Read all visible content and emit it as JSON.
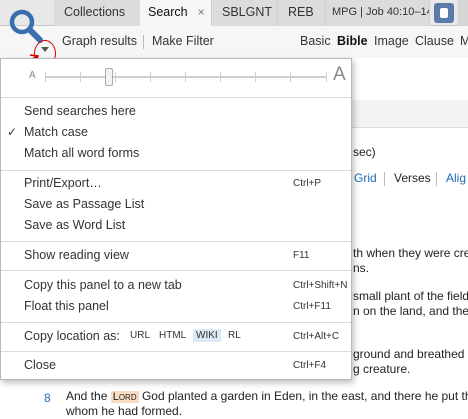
{
  "tabs": [
    {
      "label": "Collections",
      "active": false
    },
    {
      "label": "Search",
      "active": true,
      "close": "×"
    },
    {
      "label": "SBLGNT",
      "active": false
    },
    {
      "label": "REB",
      "active": false
    },
    {
      "label": "MPG | Job 40:10–14",
      "active": false
    }
  ],
  "toolbar": {
    "graph_results": "Graph results",
    "make_filter": "Make Filter",
    "search_types": [
      "Basic",
      "Bible",
      "Image",
      "Clause",
      "M"
    ]
  },
  "menu": {
    "font_size": {
      "small_label": "A",
      "large_label": "A",
      "level": 0.23
    },
    "items": {
      "send_searches_here": "Send searches here",
      "match_case": "Match case",
      "match_case_check": "✓",
      "match_all_word_forms": "Match all word forms",
      "print_export": "Print/Export…",
      "print_export_shortcut": "Ctrl+P",
      "save_as_passage_list": "Save as Passage List",
      "save_as_word_list": "Save as Word List",
      "show_reading_view": "Show reading view",
      "show_reading_view_shortcut": "F11",
      "copy_to_new_tab": "Copy this panel to a new tab",
      "copy_to_new_tab_shortcut": "Ctrl+Shift+N",
      "float_panel": "Float this panel",
      "float_panel_shortcut": "Ctrl+F11",
      "copy_location_as": "Copy location as:",
      "copy_location_shortcut": "Ctrl+Alt+C",
      "close": "Close",
      "close_shortcut": "Ctrl+F4"
    },
    "copy_formats": [
      {
        "label": "URL",
        "selected": false
      },
      {
        "label": "HTML",
        "selected": false
      },
      {
        "label": "WIKI",
        "selected": true
      },
      {
        "label": "RL",
        "selected": false
      }
    ]
  },
  "background": {
    "sec_fragment": "sec)",
    "view_options": [
      "Grid",
      "Verses",
      "Alig"
    ],
    "text_fragments": [
      "th when they were cre",
      "ns.",
      "small plant of the field",
      "n on the land, and the",
      "ground and breathed",
      "g creature."
    ],
    "verse": {
      "number": "8",
      "line1_before": "And the ",
      "lord": "Lord",
      "line1_after": " God planted a garden in Eden, in the east, and there he put th",
      "line2": "whom he had formed."
    }
  },
  "colors": {
    "accent_link": "#1e6bb8",
    "annotation": "#d60000",
    "highlight": "#f7dcc4",
    "logo": "#3a6fae"
  },
  "icons": {
    "logo": "magnifier-search-icon",
    "dropdown": "dropdown-arrow-icon",
    "settings": "panel-settings-icon"
  }
}
